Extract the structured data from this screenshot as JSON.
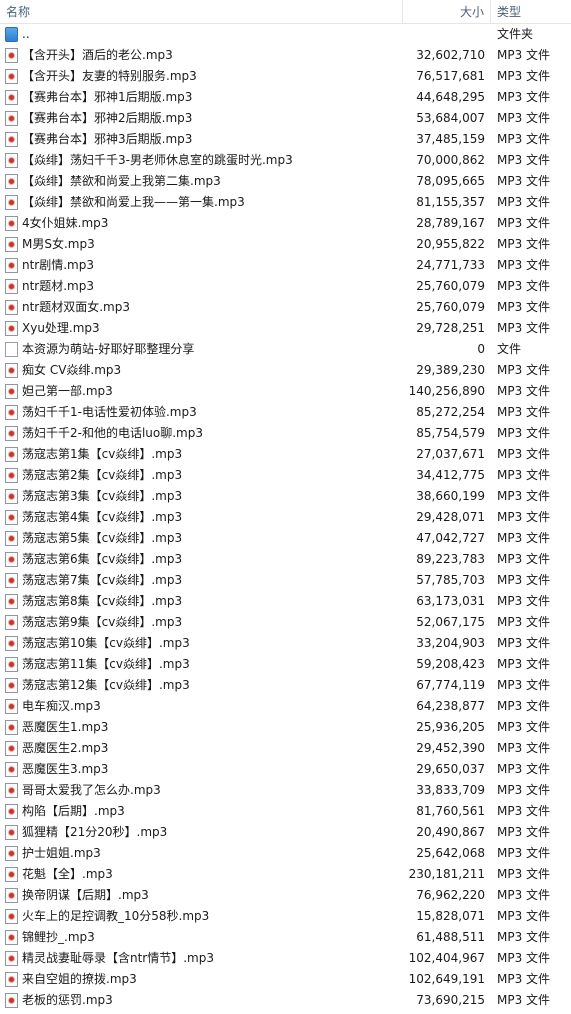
{
  "header": {
    "name": "名称",
    "size": "大小",
    "type": "类型",
    "sort_arrow": "^"
  },
  "files": [
    {
      "name": "..",
      "size": "",
      "type": "文件夹",
      "icon": "folder-up-icon"
    },
    {
      "name": "【含开头】酒后的老公.mp3",
      "size": "32,602,710",
      "type": "MP3 文件",
      "icon": "mp3-icon"
    },
    {
      "name": "【含开头】友妻的特别服务.mp3",
      "size": "76,517,681",
      "type": "MP3 文件",
      "icon": "mp3-icon"
    },
    {
      "name": "【赛弗台本】邪神1后期版.mp3",
      "size": "44,648,295",
      "type": "MP3 文件",
      "icon": "mp3-icon"
    },
    {
      "name": "【赛弗台本】邪神2后期版.mp3",
      "size": "53,684,007",
      "type": "MP3 文件",
      "icon": "mp3-icon"
    },
    {
      "name": "【赛弗台本】邪神3后期版.mp3",
      "size": "37,485,159",
      "type": "MP3 文件",
      "icon": "mp3-icon"
    },
    {
      "name": "【焱绯】荡妇千千3-男老师休息室的跳蛋时光.mp3",
      "size": "70,000,862",
      "type": "MP3 文件",
      "icon": "mp3-icon"
    },
    {
      "name": "【焱绯】禁欲和尚爱上我第二集.mp3",
      "size": "78,095,665",
      "type": "MP3 文件",
      "icon": "mp3-icon"
    },
    {
      "name": "【焱绯】禁欲和尚爱上我——第一集.mp3",
      "size": "81,155,357",
      "type": "MP3 文件",
      "icon": "mp3-icon"
    },
    {
      "name": "4女仆姐妹.mp3",
      "size": "28,789,167",
      "type": "MP3 文件",
      "icon": "mp3-icon"
    },
    {
      "name": "M男S女.mp3",
      "size": "20,955,822",
      "type": "MP3 文件",
      "icon": "mp3-icon"
    },
    {
      "name": "ntr剧情.mp3",
      "size": "24,771,733",
      "type": "MP3 文件",
      "icon": "mp3-icon"
    },
    {
      "name": "ntr题材.mp3",
      "size": "25,760,079",
      "type": "MP3 文件",
      "icon": "mp3-icon"
    },
    {
      "name": "ntr题材双面女.mp3",
      "size": "25,760,079",
      "type": "MP3 文件",
      "icon": "mp3-icon"
    },
    {
      "name": "Xyu处理.mp3",
      "size": "29,728,251",
      "type": "MP3 文件",
      "icon": "mp3-icon"
    },
    {
      "name": "本资源为萌站-好耶好耶整理分享",
      "size": "0",
      "type": "文件",
      "icon": "file-icon"
    },
    {
      "name": "痴女 CV焱绯.mp3",
      "size": "29,389,230",
      "type": "MP3 文件",
      "icon": "mp3-icon"
    },
    {
      "name": "妲己第一部.mp3",
      "size": "140,256,890",
      "type": "MP3 文件",
      "icon": "mp3-icon"
    },
    {
      "name": "荡妇千千1-电话性爱初体验.mp3",
      "size": "85,272,254",
      "type": "MP3 文件",
      "icon": "mp3-icon"
    },
    {
      "name": "荡妇千千2-和他的电话luo聊.mp3",
      "size": "85,754,579",
      "type": "MP3 文件",
      "icon": "mp3-icon"
    },
    {
      "name": "荡寇志第1集【cv焱绯】.mp3",
      "size": "27,037,671",
      "type": "MP3 文件",
      "icon": "mp3-icon"
    },
    {
      "name": "荡寇志第2集【cv焱绯】.mp3",
      "size": "34,412,775",
      "type": "MP3 文件",
      "icon": "mp3-icon"
    },
    {
      "name": "荡寇志第3集【cv焱绯】.mp3",
      "size": "38,660,199",
      "type": "MP3 文件",
      "icon": "mp3-icon"
    },
    {
      "name": "荡寇志第4集【cv焱绯】.mp3",
      "size": "29,428,071",
      "type": "MP3 文件",
      "icon": "mp3-icon"
    },
    {
      "name": "荡寇志第5集【cv焱绯】.mp3",
      "size": "47,042,727",
      "type": "MP3 文件",
      "icon": "mp3-icon"
    },
    {
      "name": "荡寇志第6集【cv焱绯】.mp3",
      "size": "89,223,783",
      "type": "MP3 文件",
      "icon": "mp3-icon"
    },
    {
      "name": "荡寇志第7集【cv焱绯】.mp3",
      "size": "57,785,703",
      "type": "MP3 文件",
      "icon": "mp3-icon"
    },
    {
      "name": "荡寇志第8集【cv焱绯】.mp3",
      "size": "63,173,031",
      "type": "MP3 文件",
      "icon": "mp3-icon"
    },
    {
      "name": "荡寇志第9集【cv焱绯】.mp3",
      "size": "52,067,175",
      "type": "MP3 文件",
      "icon": "mp3-icon"
    },
    {
      "name": "荡寇志第10集【cv焱绯】.mp3",
      "size": "33,204,903",
      "type": "MP3 文件",
      "icon": "mp3-icon"
    },
    {
      "name": "荡寇志第11集【cv焱绯】.mp3",
      "size": "59,208,423",
      "type": "MP3 文件",
      "icon": "mp3-icon"
    },
    {
      "name": "荡寇志第12集【cv焱绯】.mp3",
      "size": "67,774,119",
      "type": "MP3 文件",
      "icon": "mp3-icon"
    },
    {
      "name": "电车痴汉.mp3",
      "size": "64,238,877",
      "type": "MP3 文件",
      "icon": "mp3-icon"
    },
    {
      "name": "恶魔医生1.mp3",
      "size": "25,936,205",
      "type": "MP3 文件",
      "icon": "mp3-icon"
    },
    {
      "name": "恶魔医生2.mp3",
      "size": "29,452,390",
      "type": "MP3 文件",
      "icon": "mp3-icon"
    },
    {
      "name": "恶魔医生3.mp3",
      "size": "29,650,037",
      "type": "MP3 文件",
      "icon": "mp3-icon"
    },
    {
      "name": "哥哥太爱我了怎么办.mp3",
      "size": "33,833,709",
      "type": "MP3 文件",
      "icon": "mp3-icon"
    },
    {
      "name": "构陷【后期】.mp3",
      "size": "81,760,561",
      "type": "MP3 文件",
      "icon": "mp3-icon"
    },
    {
      "name": "狐狸精【21分20秒】.mp3",
      "size": "20,490,867",
      "type": "MP3 文件",
      "icon": "mp3-icon"
    },
    {
      "name": "护士姐姐.mp3",
      "size": "25,642,068",
      "type": "MP3 文件",
      "icon": "mp3-icon"
    },
    {
      "name": "花魁【全】.mp3",
      "size": "230,181,211",
      "type": "MP3 文件",
      "icon": "mp3-icon"
    },
    {
      "name": "换帝阴谋【后期】.mp3",
      "size": "76,962,220",
      "type": "MP3 文件",
      "icon": "mp3-icon"
    },
    {
      "name": "火车上的足控调教_10分58秒.mp3",
      "size": "15,828,071",
      "type": "MP3 文件",
      "icon": "mp3-icon"
    },
    {
      "name": "锦鲤抄_.mp3",
      "size": "61,488,511",
      "type": "MP3 文件",
      "icon": "mp3-icon"
    },
    {
      "name": "精灵战妻耻辱录【含ntr情节】.mp3",
      "size": "102,404,967",
      "type": "MP3 文件",
      "icon": "mp3-icon"
    },
    {
      "name": "来自空姐的撩拨.mp3",
      "size": "102,649,191",
      "type": "MP3 文件",
      "icon": "mp3-icon"
    },
    {
      "name": "老板的惩罚.mp3",
      "size": "73,690,215",
      "type": "MP3 文件",
      "icon": "mp3-icon"
    }
  ]
}
